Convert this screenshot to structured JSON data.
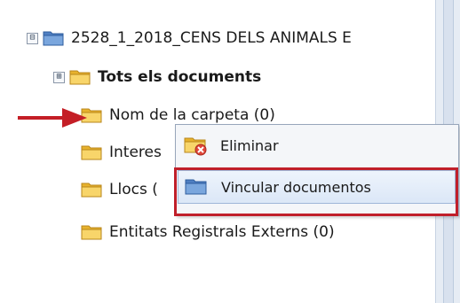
{
  "tree": {
    "root": {
      "label": "2528_1_2018_CENS DELS ANIMALS E",
      "expander": "⊟",
      "icon": "folder-open-blue-icon"
    },
    "items": [
      {
        "label": "Tots els documents",
        "expander": "⊞",
        "bold": true
      },
      {
        "label": "Nom de la carpeta (0)"
      },
      {
        "label": "Interes"
      },
      {
        "label": "Llocs ("
      },
      {
        "label": "Entitats Registrals Externs (0)"
      }
    ]
  },
  "context_menu": {
    "items": [
      {
        "label": "Eliminar",
        "icon": "folder-delete-icon"
      },
      {
        "label": "Vincular documentos",
        "icon": "folder-link-icon",
        "highlighted": true
      }
    ]
  },
  "colors": {
    "arrow": "#c41e26",
    "highlight_border": "#c01f2a",
    "folder_yellow": "#f4c542",
    "folder_blue": "#5a86c6"
  }
}
